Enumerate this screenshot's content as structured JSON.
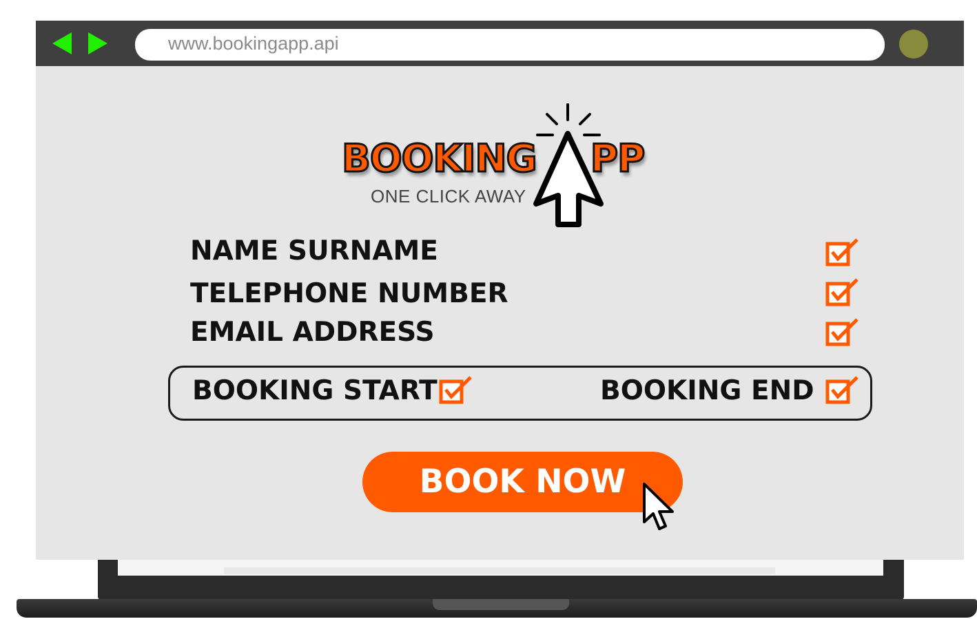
{
  "browser": {
    "url": "www.bookingapp.api"
  },
  "logo": {
    "word_left": "BOOKING",
    "word_right": "PP",
    "tagline": "ONE CLICK AWAY"
  },
  "form": {
    "fields": [
      {
        "label": "NAME SURNAME",
        "checked": true
      },
      {
        "label": "TELEPHONE NUMBER",
        "checked": true
      },
      {
        "label": "EMAIL ADDRESS",
        "checked": true
      }
    ],
    "booking_start": {
      "label": "BOOKING START",
      "checked": true
    },
    "booking_end": {
      "label": "BOOKING END",
      "checked": true
    },
    "submit_label": "BOOK NOW"
  },
  "colors": {
    "accent": "#ff5a00",
    "nav_arrows": "#22ee00",
    "topbar": "#3f3f3f",
    "page_bg": "#e6e6e6"
  },
  "icons": [
    "back-arrow-icon",
    "forward-arrow-icon",
    "cursor-icon",
    "checkbox-checked-icon"
  ]
}
